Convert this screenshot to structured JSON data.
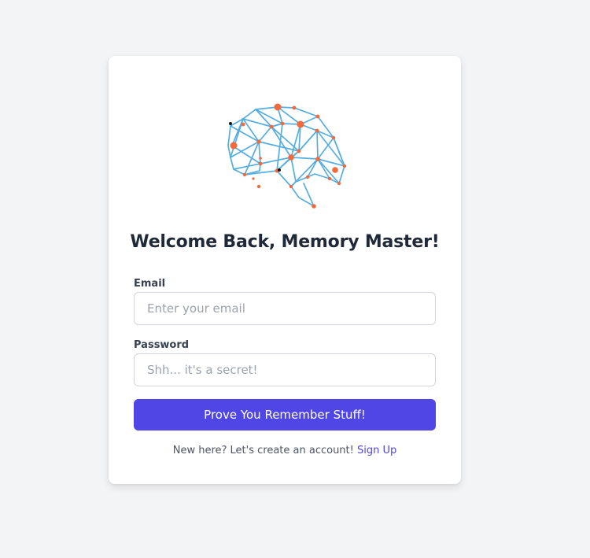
{
  "logo": {
    "icon": "brain-network-icon",
    "line_color": "#56aee0",
    "node_color": "#f2693c"
  },
  "heading": "Welcome Back, Memory Master!",
  "form": {
    "email": {
      "label": "Email",
      "placeholder": "Enter your email",
      "value": ""
    },
    "password": {
      "label": "Password",
      "placeholder": "Shh... it's a secret!",
      "value": ""
    },
    "submit_label": "Prove You Remember Stuff!"
  },
  "footer": {
    "prompt": "New here? Let's create an account!",
    "link_label": "Sign Up"
  },
  "colors": {
    "primary": "#4f46e5",
    "background": "#f3f4f6",
    "card": "#ffffff"
  }
}
